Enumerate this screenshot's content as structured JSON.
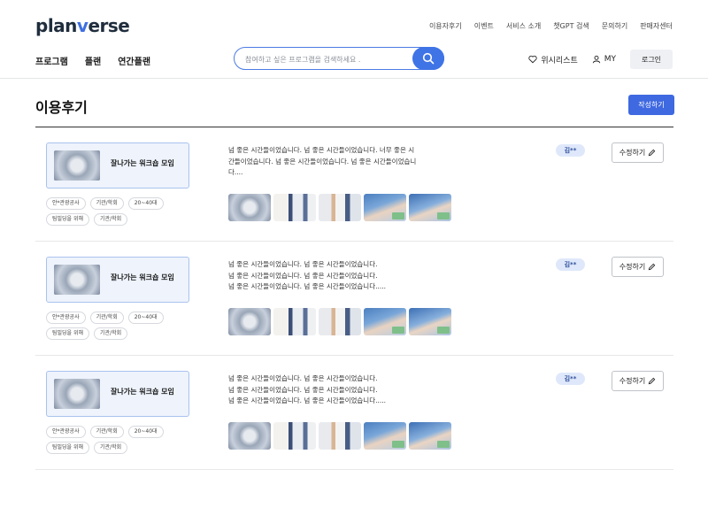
{
  "brand": {
    "logo_pre": "plan",
    "logo_accent": "v",
    "logo_post": "erse",
    "accent_color": "#3f6fe0"
  },
  "top_links": [
    "이용자후기",
    "이벤트",
    "서비스 소개",
    "챗GPT 검색",
    "문의하기",
    "판매자센터"
  ],
  "main_nav": [
    "프로그램",
    "플랜",
    "연간플랜"
  ],
  "search": {
    "placeholder": "참여하고 싶은 프로그램을 검색하세요 .",
    "button_icon": "search-icon"
  },
  "util": {
    "wishlist": "위시리스트",
    "my": "MY",
    "login": "로그인"
  },
  "page": {
    "title": "이용후기",
    "write_button": "작성하기"
  },
  "reviews": [
    {
      "program_name": "잘나가는 워크숍 모임",
      "tags": [
        "안*관광공사",
        "기관/학회",
        "20~40대",
        "팀빌딩을 위해",
        "기관/학회"
      ],
      "text_lines": [
        "넘 좋은 시간들이었습니다. 넘 좋은 시간들이었습니다. 너무 좋은 시",
        "간들이었습니다. 넘 좋은 시간들이었습니다. 넘 좋은 시간들이었습니",
        "다...."
      ],
      "photo_count": 5,
      "author": "김**",
      "edit_label": "수정하기"
    },
    {
      "program_name": "잘나가는 워크숍 모임",
      "tags": [
        "안*관광공사",
        "기관/학회",
        "20~40대",
        "팀빌딩을 위해",
        "기관/학회"
      ],
      "text_lines": [
        "넘 좋은 시간들이었습니다. 넘 좋은 시간들이었습니다.",
        "넘 좋은 시간들이었습니다. 넘 좋은 시간들이었습니다.",
        "넘 좋은 시간들이었습니다. 넘 좋은 시간들이었습니다....."
      ],
      "photo_count": 5,
      "author": "김**",
      "edit_label": "수정하기"
    },
    {
      "program_name": "잘나가는 워크숍 모임",
      "tags": [
        "안*관광공사",
        "기관/학회",
        "20~40대",
        "팀빌딩을 위해",
        "기관/학회"
      ],
      "text_lines": [
        "넘 좋은 시간들이었습니다. 넘 좋은 시간들이었습니다.",
        "넘 좋은 시간들이었습니다. 넘 좋은 시간들이었습니다.",
        "넘 좋은 시간들이었습니다. 넘 좋은 시간들이었습니다....."
      ],
      "photo_count": 5,
      "author": "김**",
      "edit_label": "수정하기"
    }
  ]
}
